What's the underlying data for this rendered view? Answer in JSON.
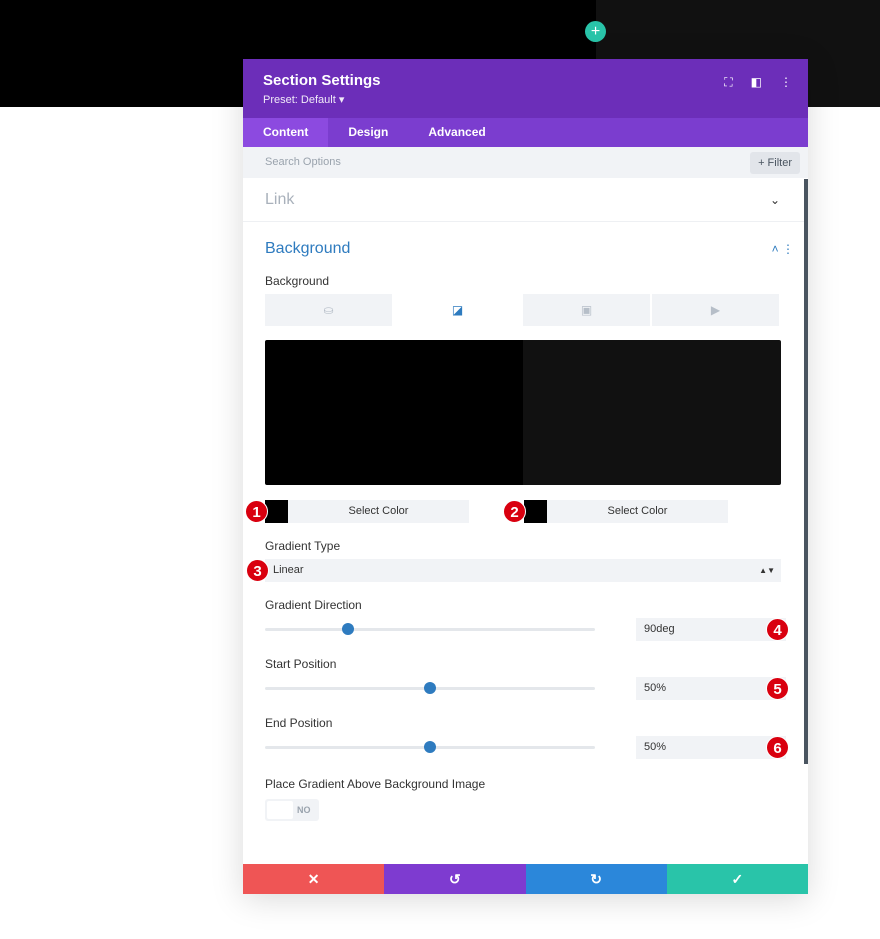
{
  "modal": {
    "title": "Section Settings",
    "preset": "Preset: Default ▾"
  },
  "tabs": [
    "Content",
    "Design",
    "Advanced"
  ],
  "search": {
    "placeholder": "Search Options",
    "filter": "+ Filter"
  },
  "link": {
    "title": "Link"
  },
  "background": {
    "title": "Background",
    "label": "Background",
    "types": [
      "paint-bucket-icon",
      "gradient-icon",
      "image-icon",
      "video-icon"
    ],
    "gradient_colors": [
      "#000000",
      "#111111"
    ],
    "color_buttons": [
      "Select Color",
      "Select Color"
    ],
    "gradient_type_label": "Gradient Type",
    "gradient_type": "Linear",
    "direction_label": "Gradient Direction",
    "direction": "90deg",
    "direction_fraction": 0.25,
    "start_label": "Start Position",
    "start": "50%",
    "start_fraction": 0.5,
    "end_label": "End Position",
    "end": "50%",
    "end_fraction": 0.5,
    "place_label": "Place Gradient Above Background Image",
    "place_value": "NO"
  },
  "markers": [
    "1",
    "2",
    "3",
    "4",
    "5",
    "6"
  ]
}
